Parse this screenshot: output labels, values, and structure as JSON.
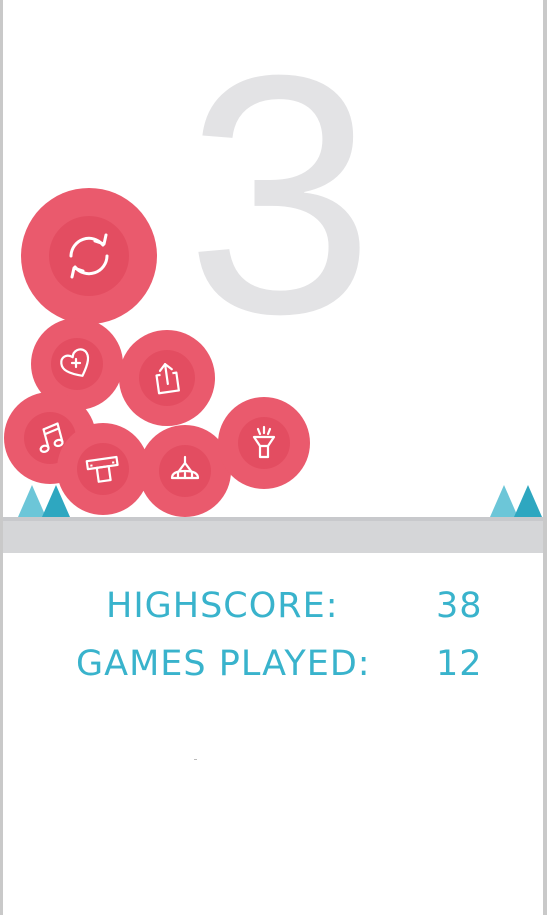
{
  "game": {
    "current_score": "3",
    "colors": {
      "accent": "#ea5a6d",
      "accent_dark": "#e34d61",
      "text": "#39b3cc",
      "spike_light": "#6cc6d8",
      "spike_dark": "#2ea7c0",
      "ground": "#d5d6d8",
      "score_digit": "#e3e3e5"
    }
  },
  "menu": {
    "buttons": [
      {
        "id": "restart",
        "icon": "refresh-icon"
      },
      {
        "id": "like",
        "icon": "heart-plus-icon"
      },
      {
        "id": "share",
        "icon": "share-icon"
      },
      {
        "id": "music",
        "icon": "music-note-icon"
      },
      {
        "id": "leaderboard",
        "icon": "podium-icon"
      },
      {
        "id": "characters",
        "icon": "ufo-icon"
      },
      {
        "id": "hint",
        "icon": "flashlight-icon"
      }
    ]
  },
  "stats": {
    "highscore_label": "HIGHSCORE:",
    "highscore_value": "38",
    "games_played_label": "GAMES PLAYED:",
    "games_played_value": "12"
  }
}
